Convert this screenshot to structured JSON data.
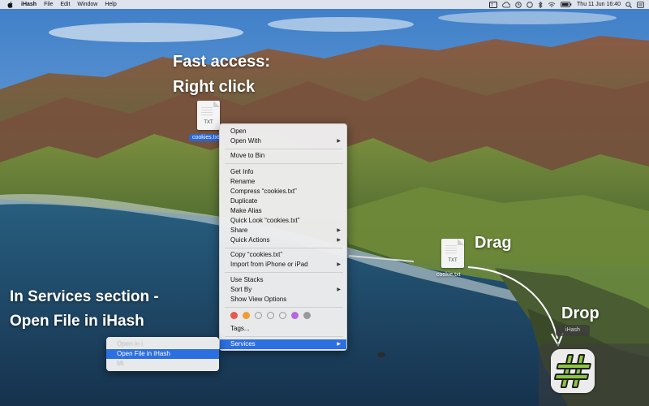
{
  "menubar": {
    "app_name": "iHash",
    "menus": [
      "File",
      "Edit",
      "Window",
      "Help"
    ],
    "clock": "Thu 11 Jun  16:40"
  },
  "captions": {
    "fast_access": "Fast access:",
    "right_click": "Right click",
    "services_line1": "In Services section -",
    "services_line2": "Open File in iHash",
    "drag": "Drag",
    "drop": "Drop"
  },
  "files": {
    "first": {
      "ext": "TXT",
      "label": "cookies.txt"
    },
    "second": {
      "ext": "TXT",
      "label": "cookie.txt"
    }
  },
  "context_menu": {
    "items": {
      "open": "Open",
      "open_with": "Open With",
      "move_to_bin": "Move to Bin",
      "get_info": "Get Info",
      "rename": "Rename",
      "compress": "Compress “cookies.txt”",
      "duplicate": "Duplicate",
      "make_alias": "Make Alias",
      "quick_look": "Quick Look “cookies.txt”",
      "share": "Share",
      "quick_actions": "Quick Actions",
      "copy": "Copy “cookies.txt”",
      "import": "Import from iPhone or iPad",
      "use_stacks": "Use Stacks",
      "sort_by": "Sort By",
      "show_view_options": "Show View Options",
      "tags": "Tags...",
      "services": "Services"
    },
    "tag_colors": [
      "#e8564e",
      "#f29a33",
      "hollow",
      "hollow",
      "hollow",
      "#b667e0",
      "#9a9a9a"
    ]
  },
  "services_submenu": {
    "items": [
      "Open in i",
      "Open File in iHash",
      "Mi"
    ]
  },
  "dock": {
    "hover_label": "iHash"
  }
}
